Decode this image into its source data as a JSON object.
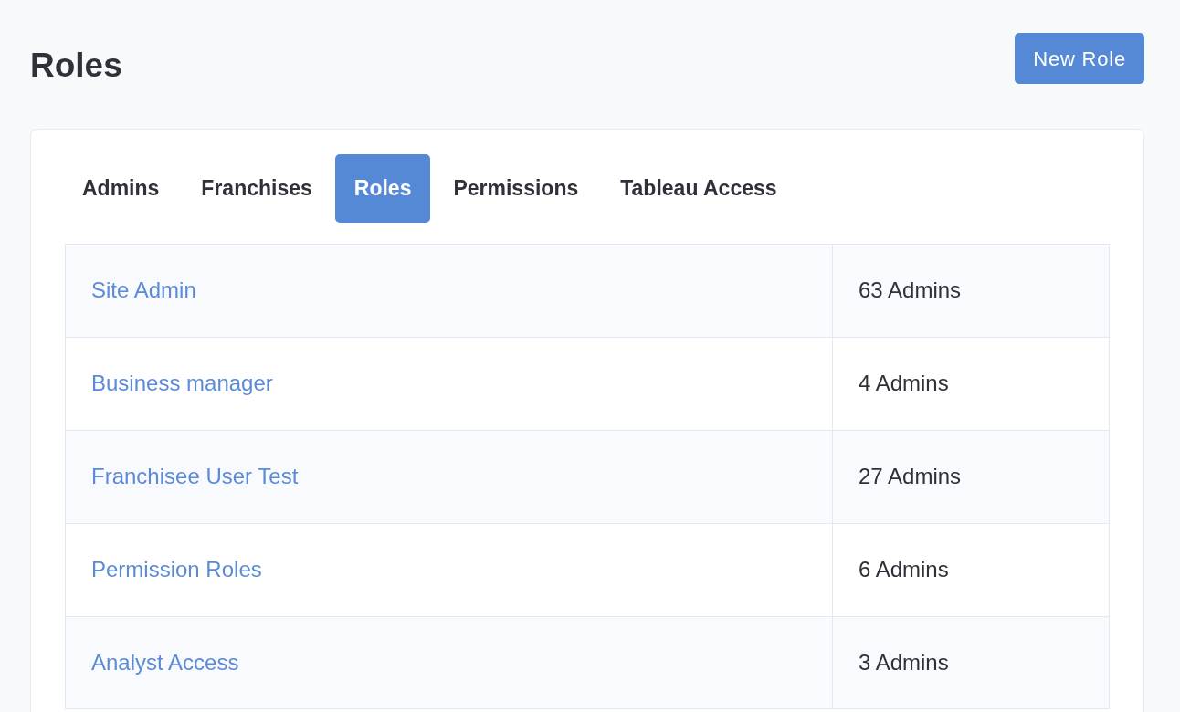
{
  "header": {
    "title": "Roles",
    "new_button": "New Role"
  },
  "tabs": [
    {
      "label": "Admins",
      "selected": false
    },
    {
      "label": "Franchises",
      "selected": false
    },
    {
      "label": "Roles",
      "selected": true
    },
    {
      "label": "Permissions",
      "selected": false
    },
    {
      "label": "Tableau Access",
      "selected": false
    }
  ],
  "table": {
    "rows": [
      {
        "role": "Site Admin",
        "admin_count": "63 Admins"
      },
      {
        "role": "Business manager",
        "admin_count": "4 Admins"
      },
      {
        "role": "Franchisee User Test",
        "admin_count": "27 Admins"
      },
      {
        "role": "Permission Roles",
        "admin_count": "6 Admins"
      },
      {
        "role": "Analyst Access",
        "admin_count": "3 Admins"
      }
    ]
  }
}
